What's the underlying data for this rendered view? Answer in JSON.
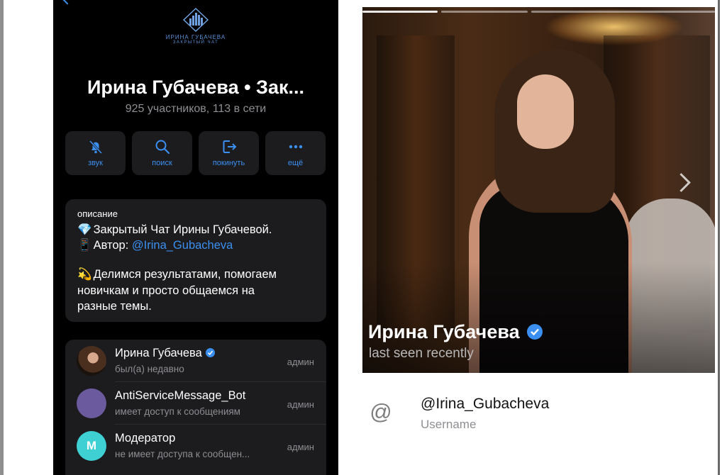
{
  "chat": {
    "logo": {
      "name": "ИРИНА ГУБАЧЕВА",
      "subtitle": "ЗАКРЫТЫЙ ЧАТ",
      "icon": "building-logo-icon"
    },
    "title": "Ирина Губачева • Зак...",
    "subtitle": "925 участников, 113 в сети",
    "actions": [
      {
        "label": "звук",
        "icon": "bell-slash-icon"
      },
      {
        "label": "поиск",
        "icon": "search-icon"
      },
      {
        "label": "покинуть",
        "icon": "leave-icon"
      },
      {
        "label": "ещё",
        "icon": "more-icon"
      }
    ],
    "description": {
      "label": "описание",
      "line1_emoji": "💎",
      "line1_text": "Закрытый Чат Ирины Губачевой.",
      "line2_emoji": "📱",
      "line2_text": "Автор: ",
      "line2_link": "@Irina_Gubacheva",
      "line3_emoji": "💫",
      "line3_text": "Делимся результатами, помогаем",
      "line4_text": "новичкам и просто общаемся на",
      "line5_text": "разные темы."
    },
    "members": [
      {
        "name": "Ирина Губачева",
        "status": "был(а) недавно",
        "role": "админ",
        "verified": true,
        "avatar_color": "#3a2a20"
      },
      {
        "name": "AntiServiceMessage_Bot",
        "status": "имеет доступ к сообщениям",
        "role": "админ",
        "verified": false,
        "avatar_color": "#6b5a9e"
      },
      {
        "name": "Модератор",
        "status": "не имеет доступа к сообщен...",
        "role": "админ",
        "verified": false,
        "avatar_letter": "М",
        "avatar_color": "#3fd0d4"
      }
    ]
  },
  "profile": {
    "name": "Ирина Губачева",
    "status": "last seen recently",
    "username": "@Irina_Gubacheva",
    "username_label": "Username",
    "at_symbol": "@",
    "story_count": 3,
    "current_story": 1
  },
  "colors": {
    "accent": "#3b8ff0",
    "panel": "#1c1c1e",
    "muted": "#8e8e93"
  }
}
